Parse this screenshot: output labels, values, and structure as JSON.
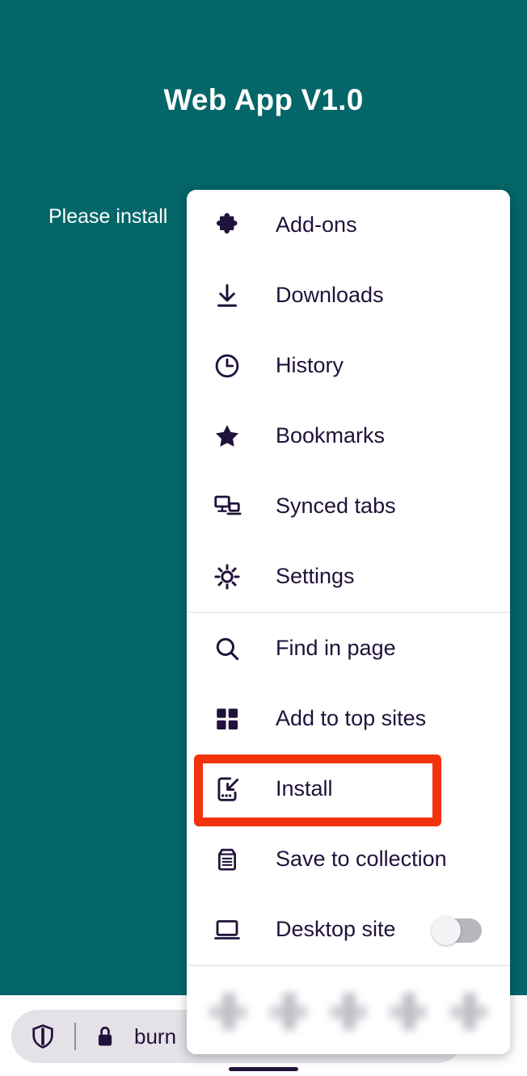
{
  "theme": {
    "background": "#046668",
    "menu_background": "#ffffff",
    "text_dark": "#20123a",
    "highlight": "#f4330c",
    "divider": "#eceaee",
    "toggle_track_off": "#b8b5bd"
  },
  "page": {
    "title": "Web App V1.0",
    "subtitle": "Please install"
  },
  "browser_toolbar": {
    "shield_icon": "shield-icon",
    "lock_icon": "lock-icon",
    "url": "burn"
  },
  "menu": {
    "groups": [
      {
        "items": [
          {
            "label": "Add-ons",
            "icon": "puzzle-piece-icon"
          },
          {
            "label": "Downloads",
            "icon": "download-icon"
          },
          {
            "label": "History",
            "icon": "clock-icon"
          },
          {
            "label": "Bookmarks",
            "icon": "star-icon"
          },
          {
            "label": "Synced tabs",
            "icon": "synced-devices-icon"
          },
          {
            "label": "Settings",
            "icon": "gear-icon"
          }
        ]
      },
      {
        "items": [
          {
            "label": "Find in page",
            "icon": "search-icon"
          },
          {
            "label": "Add to top sites",
            "icon": "grid-icon"
          },
          {
            "label": "Install",
            "icon": "install-to-phone-icon",
            "highlighted": true
          },
          {
            "label": "Save to collection",
            "icon": "collection-icon"
          },
          {
            "label": "Desktop site",
            "icon": "laptop-icon",
            "toggle": "off"
          }
        ]
      }
    ],
    "quick_actions_count": 5
  }
}
